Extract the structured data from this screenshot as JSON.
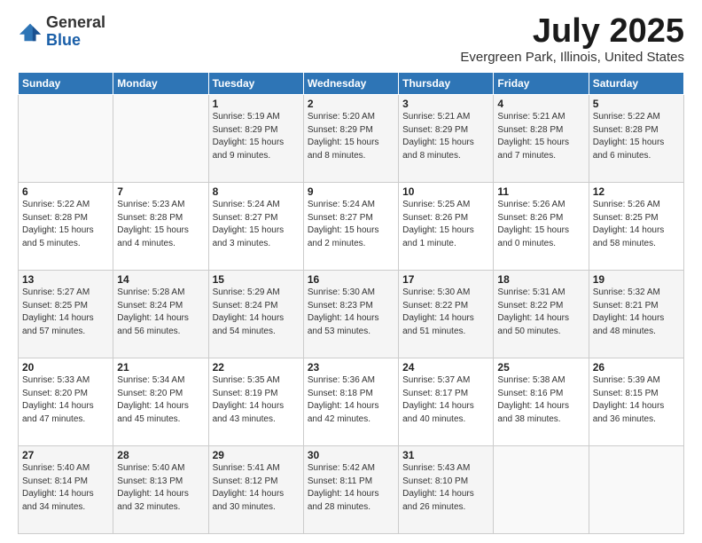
{
  "logo": {
    "general": "General",
    "blue": "Blue"
  },
  "title": "July 2025",
  "subtitle": "Evergreen Park, Illinois, United States",
  "days_of_week": [
    "Sunday",
    "Monday",
    "Tuesday",
    "Wednesday",
    "Thursday",
    "Friday",
    "Saturday"
  ],
  "weeks": [
    [
      {
        "day": "",
        "info": ""
      },
      {
        "day": "",
        "info": ""
      },
      {
        "day": "1",
        "info": "Sunrise: 5:19 AM\nSunset: 8:29 PM\nDaylight: 15 hours and 9 minutes."
      },
      {
        "day": "2",
        "info": "Sunrise: 5:20 AM\nSunset: 8:29 PM\nDaylight: 15 hours and 8 minutes."
      },
      {
        "day": "3",
        "info": "Sunrise: 5:21 AM\nSunset: 8:29 PM\nDaylight: 15 hours and 8 minutes."
      },
      {
        "day": "4",
        "info": "Sunrise: 5:21 AM\nSunset: 8:28 PM\nDaylight: 15 hours and 7 minutes."
      },
      {
        "day": "5",
        "info": "Sunrise: 5:22 AM\nSunset: 8:28 PM\nDaylight: 15 hours and 6 minutes."
      }
    ],
    [
      {
        "day": "6",
        "info": "Sunrise: 5:22 AM\nSunset: 8:28 PM\nDaylight: 15 hours and 5 minutes."
      },
      {
        "day": "7",
        "info": "Sunrise: 5:23 AM\nSunset: 8:28 PM\nDaylight: 15 hours and 4 minutes."
      },
      {
        "day": "8",
        "info": "Sunrise: 5:24 AM\nSunset: 8:27 PM\nDaylight: 15 hours and 3 minutes."
      },
      {
        "day": "9",
        "info": "Sunrise: 5:24 AM\nSunset: 8:27 PM\nDaylight: 15 hours and 2 minutes."
      },
      {
        "day": "10",
        "info": "Sunrise: 5:25 AM\nSunset: 8:26 PM\nDaylight: 15 hours and 1 minute."
      },
      {
        "day": "11",
        "info": "Sunrise: 5:26 AM\nSunset: 8:26 PM\nDaylight: 15 hours and 0 minutes."
      },
      {
        "day": "12",
        "info": "Sunrise: 5:26 AM\nSunset: 8:25 PM\nDaylight: 14 hours and 58 minutes."
      }
    ],
    [
      {
        "day": "13",
        "info": "Sunrise: 5:27 AM\nSunset: 8:25 PM\nDaylight: 14 hours and 57 minutes."
      },
      {
        "day": "14",
        "info": "Sunrise: 5:28 AM\nSunset: 8:24 PM\nDaylight: 14 hours and 56 minutes."
      },
      {
        "day": "15",
        "info": "Sunrise: 5:29 AM\nSunset: 8:24 PM\nDaylight: 14 hours and 54 minutes."
      },
      {
        "day": "16",
        "info": "Sunrise: 5:30 AM\nSunset: 8:23 PM\nDaylight: 14 hours and 53 minutes."
      },
      {
        "day": "17",
        "info": "Sunrise: 5:30 AM\nSunset: 8:22 PM\nDaylight: 14 hours and 51 minutes."
      },
      {
        "day": "18",
        "info": "Sunrise: 5:31 AM\nSunset: 8:22 PM\nDaylight: 14 hours and 50 minutes."
      },
      {
        "day": "19",
        "info": "Sunrise: 5:32 AM\nSunset: 8:21 PM\nDaylight: 14 hours and 48 minutes."
      }
    ],
    [
      {
        "day": "20",
        "info": "Sunrise: 5:33 AM\nSunset: 8:20 PM\nDaylight: 14 hours and 47 minutes."
      },
      {
        "day": "21",
        "info": "Sunrise: 5:34 AM\nSunset: 8:20 PM\nDaylight: 14 hours and 45 minutes."
      },
      {
        "day": "22",
        "info": "Sunrise: 5:35 AM\nSunset: 8:19 PM\nDaylight: 14 hours and 43 minutes."
      },
      {
        "day": "23",
        "info": "Sunrise: 5:36 AM\nSunset: 8:18 PM\nDaylight: 14 hours and 42 minutes."
      },
      {
        "day": "24",
        "info": "Sunrise: 5:37 AM\nSunset: 8:17 PM\nDaylight: 14 hours and 40 minutes."
      },
      {
        "day": "25",
        "info": "Sunrise: 5:38 AM\nSunset: 8:16 PM\nDaylight: 14 hours and 38 minutes."
      },
      {
        "day": "26",
        "info": "Sunrise: 5:39 AM\nSunset: 8:15 PM\nDaylight: 14 hours and 36 minutes."
      }
    ],
    [
      {
        "day": "27",
        "info": "Sunrise: 5:40 AM\nSunset: 8:14 PM\nDaylight: 14 hours and 34 minutes."
      },
      {
        "day": "28",
        "info": "Sunrise: 5:40 AM\nSunset: 8:13 PM\nDaylight: 14 hours and 32 minutes."
      },
      {
        "day": "29",
        "info": "Sunrise: 5:41 AM\nSunset: 8:12 PM\nDaylight: 14 hours and 30 minutes."
      },
      {
        "day": "30",
        "info": "Sunrise: 5:42 AM\nSunset: 8:11 PM\nDaylight: 14 hours and 28 minutes."
      },
      {
        "day": "31",
        "info": "Sunrise: 5:43 AM\nSunset: 8:10 PM\nDaylight: 14 hours and 26 minutes."
      },
      {
        "day": "",
        "info": ""
      },
      {
        "day": "",
        "info": ""
      }
    ]
  ]
}
